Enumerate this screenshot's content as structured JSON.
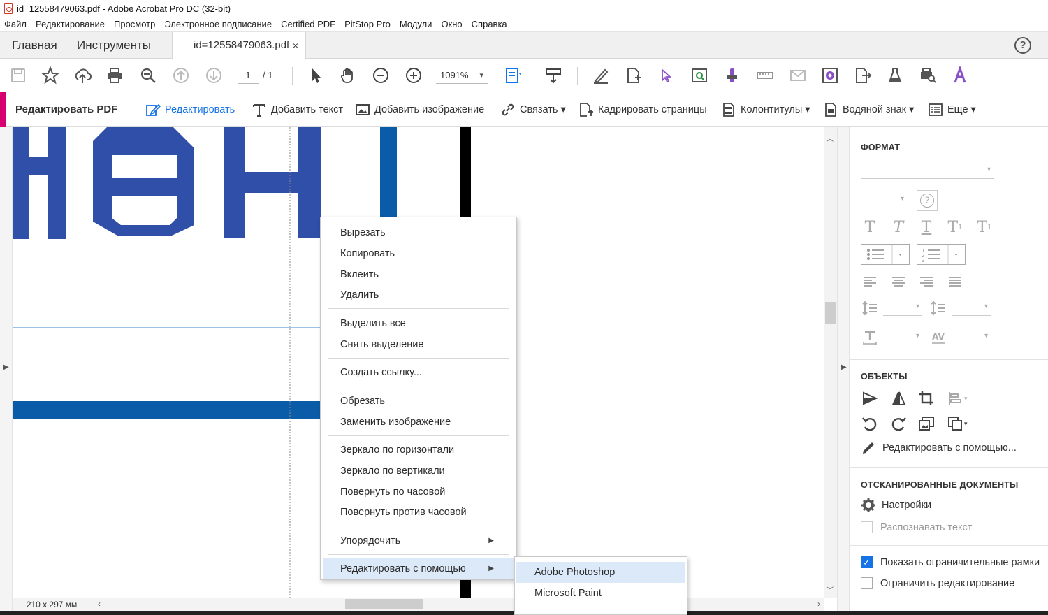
{
  "window": {
    "title": "id=12558479063.pdf - Adobe Acrobat Pro DC (32-bit)"
  },
  "menu": [
    "Файл",
    "Редактирование",
    "Просмотр",
    "Электронное подписание",
    "Certified PDF",
    "PitStop Pro",
    "Модули",
    "Окно",
    "Справка"
  ],
  "tabs": {
    "home": "Главная",
    "tools": "Инструменты",
    "document": "id=12558479063.pdf",
    "close": "×"
  },
  "toolbar": {
    "page_current": "1",
    "page_total": "/ 1",
    "zoom": "1091%"
  },
  "editbar": {
    "title": "Редактировать PDF",
    "edit": "Редактировать",
    "add_text": "Добавить текст",
    "add_image": "Добавить изображение",
    "link": "Связать ▾",
    "crop": "Кадрировать страницы",
    "header_footer": "Колонтитулы ▾",
    "watermark": "Водяной знак ▾",
    "more": "Еще ▾"
  },
  "status": {
    "page_size": "210 x 297 мм"
  },
  "context_menu": [
    {
      "label": "Вырезать"
    },
    {
      "label": "Копировать"
    },
    {
      "label": "Вклеить"
    },
    {
      "label": "Удалить"
    },
    {
      "label": "Выделить все"
    },
    {
      "label": "Снять выделение"
    },
    {
      "label": "Создать ссылку..."
    },
    {
      "label": "Обрезать"
    },
    {
      "label": "Заменить изображение"
    },
    {
      "label": "Зеркало по горизонтали"
    },
    {
      "label": "Зеркало по вертикали"
    },
    {
      "label": "Повернуть по часовой"
    },
    {
      "label": "Повернуть против часовой"
    },
    {
      "label": "Упорядочить"
    },
    {
      "label": "Редактировать с помощью"
    }
  ],
  "submenu": [
    {
      "label": "Adobe Photoshop"
    },
    {
      "label": "Microsoft Paint"
    }
  ],
  "panel": {
    "format_heading": "ФОРМАТ",
    "objects_heading": "ОБЪЕКТЫ",
    "edit_with": "Редактировать с помощью...",
    "scanned_heading": "ОТСКАНИРОВАННЫЕ ДОКУМЕНТЫ",
    "settings": "Настройки",
    "recognize": "Распознавать текст",
    "show_boxes": "Показать ограничительные рамки",
    "restrict": "Ограничить редактирование",
    "show_boxes_checked": true,
    "restrict_checked": false
  },
  "colors": {
    "accent": "#1473e6",
    "edit_bar": "#d6006e",
    "logo_blue": "#2f4fa8",
    "stripe_blue": "#0b5ca8"
  }
}
